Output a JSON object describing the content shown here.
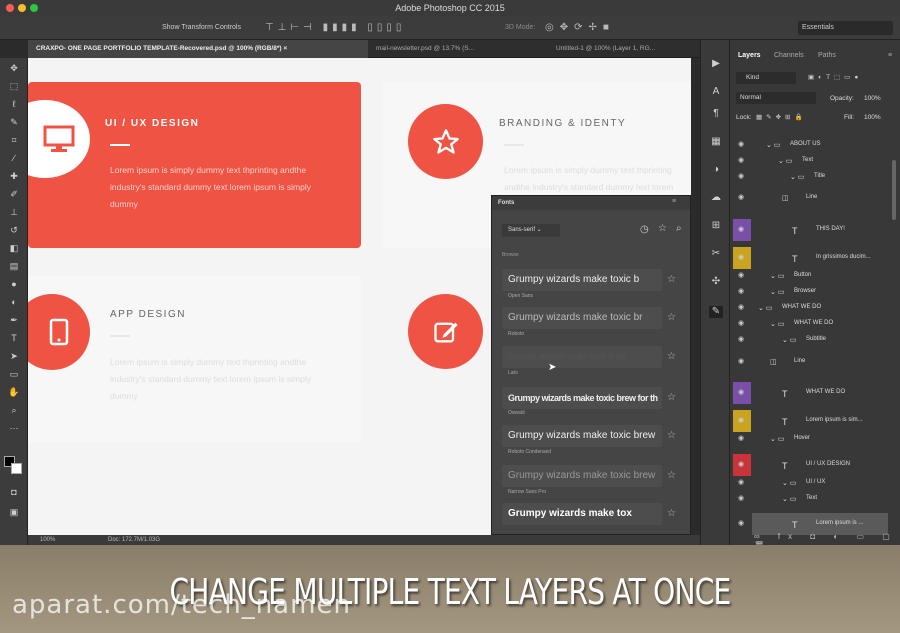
{
  "window": {
    "title": "Adobe Photoshop CC 2015"
  },
  "options_bar": {
    "show_transform": "Show Transform Controls",
    "workspace": "Essentials",
    "mode_3d": "3D Mode:"
  },
  "doc_tabs": [
    {
      "label": "CRAXPO- ONE PAGE PORTFOLIO TEMPLATE-Recovered.psd @ 100% (RGB/8*) ×"
    },
    {
      "label": "mail-newsletter.psd @ 13.7% (S..."
    },
    {
      "label": "Untitled-1 @ 100% (Layer 1, RG..."
    }
  ],
  "canvas": {
    "card1": {
      "heading": "UI / UX DESIGN",
      "body": "Lorem ipsum is simply dummy text thprinting andthe industry's standard dummy text lorem ipsum is simply dummy"
    },
    "card2": {
      "heading": "BRANDING & IDENTY",
      "body": "Lorem ipsum is simply dummy text thprinting andthe industry's standard dummy text lorem ipsum is simply dummy"
    },
    "card3": {
      "heading": "APP DESIGN",
      "body": "Lorem ipsum is simply dummy text thprinting andthe industry's standard dummy text lorem ipsum is simply dummy"
    }
  },
  "status": {
    "zoom": "100%",
    "doc": "Doc: 172.7M/1.03G"
  },
  "fonts_panel": {
    "title": "Fonts",
    "filter": "Sans-serif",
    "section": "Browse",
    "items": [
      {
        "sample": "Grumpy wizards make toxic b",
        "name": "Open Sans"
      },
      {
        "sample": "Grumpy wizards make toxic br",
        "name": "Roboto"
      },
      {
        "sample": "Grumpy wizards make toxic brew",
        "name": "Lato"
      },
      {
        "sample": "Grumpy wizards make toxic brew for th",
        "name": "Oswald"
      },
      {
        "sample": "Grumpy wizards make toxic brew",
        "name": "Roboto Condensed"
      },
      {
        "sample": "Grumpy wizards make toxic brew",
        "name": "Narrow Sans Pro"
      },
      {
        "sample": "Grumpy wizards make tox",
        "name": ""
      }
    ]
  },
  "layers_panel": {
    "tabs": [
      "Layers",
      "Channels",
      "Paths"
    ],
    "kind": "Kind",
    "blend": "Normal",
    "opacity_label": "Opacity:",
    "opacity": "100%",
    "lock_label": "Lock:",
    "fill_label": "Fill:",
    "fill": "100%",
    "rows": [
      "ABOUT US",
      "Text",
      "Title",
      "Line",
      "THIS DAY!",
      "In grissimos ducim...",
      "Button",
      "Browser",
      "WHAT WE DO",
      "WHAT WE DO",
      "Subtitle",
      "Line",
      "WHAT WE DO",
      "Lorem ipsum is sim...",
      "Hover",
      "UI / UX DESIGN",
      "UI / UX",
      "Text",
      "Lorem ipsum is ..."
    ]
  },
  "caption": "CHANGE MULTIPLE TEXT LAYERS AT ONCE",
  "watermark": "aparat.com/tech_namen",
  "colors": {
    "accent_red": "#ef5344",
    "purple_label": "#7a4fa8",
    "yellow_label": "#c9a421",
    "red_label": "#c9343a"
  }
}
